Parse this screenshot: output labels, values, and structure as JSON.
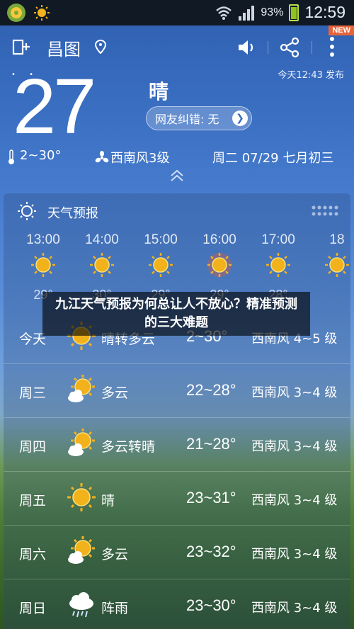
{
  "status_bar": {
    "battery_percent": "93%",
    "time": "12:59"
  },
  "badge": {
    "new": "NEW"
  },
  "topbar": {
    "city": "昌图"
  },
  "current": {
    "publish_time": "今天12:43 发布",
    "temperature": "27",
    "condition": "晴",
    "report_button": "网友纠错: 无",
    "temp_range": "2~30°",
    "wind": "西南风3级",
    "date": "周二 07/29 七月初三"
  },
  "forecast_panel": {
    "title": "天气预报",
    "hourly": [
      {
        "time": "13:00",
        "temp": "29°"
      },
      {
        "time": "14:00",
        "temp": "30°"
      },
      {
        "time": "15:00",
        "temp": "29°"
      },
      {
        "time": "16:00",
        "temp": "29°"
      },
      {
        "time": "17:00",
        "temp": "28°"
      },
      {
        "time": "18",
        "temp": ""
      }
    ],
    "daily": [
      {
        "day": "今天",
        "cond": "晴转多云",
        "temp": "2~30°",
        "wind": "西南风 4~5 级",
        "icon": "sun-icon"
      },
      {
        "day": "周三",
        "cond": "多云",
        "temp": "22~28°",
        "wind": "西南风 3~4 级",
        "icon": "partly-cloudy-icon"
      },
      {
        "day": "周四",
        "cond": "多云转晴",
        "temp": "21~28°",
        "wind": "西南风 3~4 级",
        "icon": "partly-cloudy-icon"
      },
      {
        "day": "周五",
        "cond": "晴",
        "temp": "23~31°",
        "wind": "西南风 3~4 级",
        "icon": "sun-icon"
      },
      {
        "day": "周六",
        "cond": "多云",
        "temp": "23~32°",
        "wind": "西南风 3~4 级",
        "icon": "partly-cloudy-icon"
      },
      {
        "day": "周日",
        "cond": "阵雨",
        "temp": "23~30°",
        "wind": "西南风 3~4 级",
        "icon": "rain-icon"
      }
    ]
  },
  "overlay_caption": "九江天气预报为何总让人不放心？精准预测的三大难题",
  "colors": {
    "sun": "#f2b21c",
    "badge": "#e8633a",
    "battery": "#8fc31f"
  }
}
